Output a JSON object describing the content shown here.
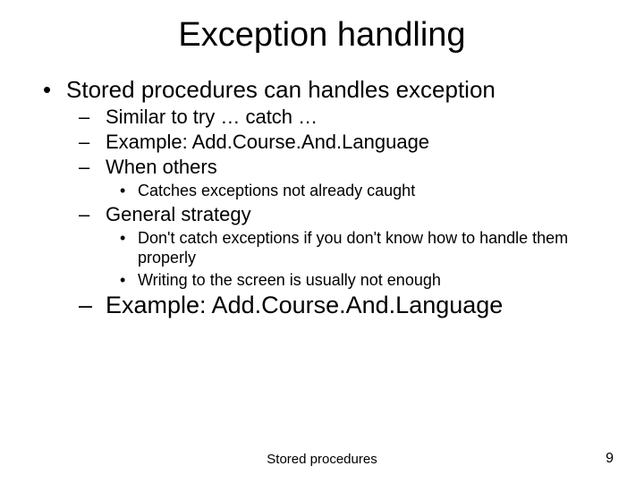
{
  "title": "Exception handling",
  "b1": "Stored procedures can handles exception",
  "s1": "Similar to try … catch …",
  "s2": "Example: Add.Course.And.Language",
  "s3": "When others",
  "s3a": "Catches exceptions not already caught",
  "s4": "General strategy",
  "s4a": "Don't catch exceptions if you don't know how to handle them properly",
  "s4b": "Writing to the screen is usually not enough",
  "s5": "Example: Add.Course.And.Language",
  "footer": "Stored procedures",
  "page": "9"
}
